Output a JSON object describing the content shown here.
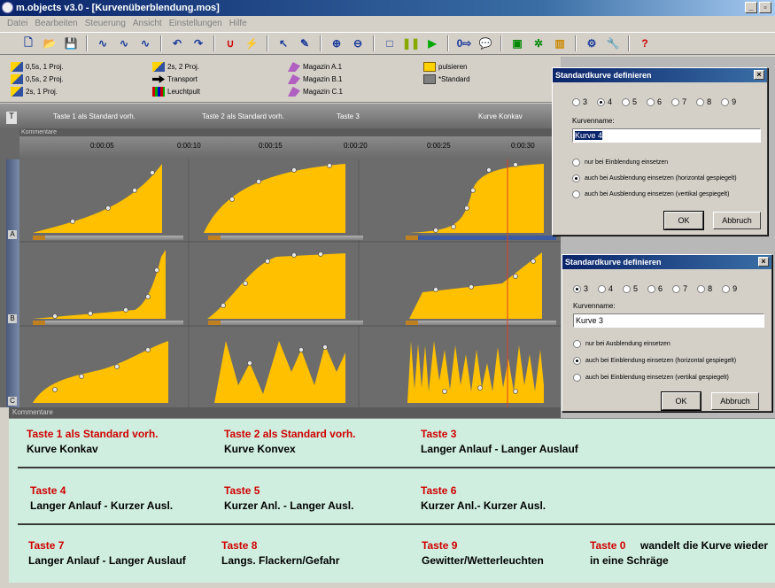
{
  "window": {
    "title": "m.objects v3.0 - [Kurvenüberblendung.mos]",
    "controls": [
      "_",
      "▫",
      "×"
    ]
  },
  "menu": [
    "Datei",
    "Bearbeiten",
    "Steuerung",
    "Ansicht",
    "Einstellungen",
    "Hilfe"
  ],
  "toolbar": [
    "new-icon",
    "open-icon",
    "save-icon",
    "curve-icon",
    "curve-icon",
    "curve-icon",
    "undo-icon",
    "redo-icon",
    "magnet-icon",
    "link-icon",
    "pointer-icon",
    "pen-icon",
    "zoom-in-icon",
    "zoom-out-icon",
    "stop-icon",
    "pause-icon",
    "play-icon",
    "counter-icon",
    "speech-icon",
    "monitor-icon",
    "sync-icon",
    "grid-icon",
    "settings-icon",
    "wrench-icon",
    "help-icon"
  ],
  "objects": [
    {
      "label": "0,5s, 1 Proj.",
      "icon": "yellow"
    },
    {
      "label": "0,5s, 2 Proj.",
      "icon": "yellow"
    },
    {
      "label": "2s, 1 Proj.",
      "icon": "yellow"
    },
    {
      "label": "2s, 2 Proj.",
      "icon": "yellow"
    },
    {
      "label": "Transport",
      "icon": "arrow"
    },
    {
      "label": "Leuchtpult",
      "icon": "light"
    },
    {
      "label": "Magazin A.1",
      "icon": "mag"
    },
    {
      "label": "Magazin B.1",
      "icon": "mag"
    },
    {
      "label": "Magazin C.1",
      "icon": "mag"
    },
    {
      "label": "pulsieren",
      "icon": "puls"
    },
    {
      "label": "*Standard",
      "icon": "std"
    }
  ],
  "track_header": {
    "row_letter": "T",
    "labels": [
      "Taste 1 als Standard vorh.",
      "Taste 2 als Standard vorh.",
      "Taste 3",
      "Kurve Konkav"
    ]
  },
  "kommentare_label": "Kommentare",
  "ruler_ticks": [
    "0:00:05",
    "0:00:10",
    "0:00:15",
    "0:00:20",
    "0:00:25",
    "0:00:30"
  ],
  "row_labels": [
    "A",
    "B",
    "C"
  ],
  "comments": {
    "row1": [
      {
        "key": "Taste 1 als Standard vorh.",
        "value": "Kurve Konkav"
      },
      {
        "key": "Taste 2 als Standard vorh.",
        "value": "Kurve Konvex"
      },
      {
        "key": "Taste 3",
        "value": "Langer Anlauf - Langer Auslauf"
      }
    ],
    "row2": [
      {
        "key": "Taste 4",
        "value": "Langer Anlauf - Kurzer Ausl."
      },
      {
        "key": "Taste 5",
        "value": "Kurzer Anl. - Langer Ausl."
      },
      {
        "key": "Taste 6",
        "value": "Kurzer Anl.- Kurzer Ausl."
      }
    ],
    "row3": [
      {
        "key": "Taste 7",
        "value": "Langer Anlauf - Langer Auslauf"
      },
      {
        "key": "Taste 8",
        "value": "Langs. Flackern/Gefahr"
      },
      {
        "key": "Taste 9",
        "value": "Gewitter/Wetterleuchten"
      }
    ],
    "taste0_key": "Taste 0",
    "taste0_text1": " wandelt die Kurve wieder",
    "taste0_text2": "in eine Schräge"
  },
  "dialog1": {
    "title": "Standardkurve definieren",
    "options": [
      "3",
      "4",
      "5",
      "6",
      "7",
      "8",
      "9"
    ],
    "selected": "4",
    "name_label": "Kurvenname:",
    "name_value": "Kurve 4",
    "radio_opts": [
      "nur bei Einblendung einsetzen",
      "auch bei Ausblendung einsetzen (horizontal gespiegelt)",
      "auch bei Ausblendung einsetzen (vertikal gespiegelt)"
    ],
    "radio_selected": 1,
    "ok": "OK",
    "cancel": "Abbruch"
  },
  "dialog2": {
    "title": "Standardkurve definieren",
    "options": [
      "3",
      "4",
      "5",
      "6",
      "7",
      "8",
      "9"
    ],
    "selected": "3",
    "name_label": "Kurvenname:",
    "name_value": "Kurve 3",
    "radio_opts": [
      "nur bei Ausblendung einsetzen",
      "auch bei Einblendung einsetzen (horizontal gespiegelt)",
      "auch bei Einblendung einsetzen (vertikal gespiegelt)"
    ],
    "radio_selected": 1,
    "ok": "OK",
    "cancel": "Abbruch"
  },
  "colors": {
    "curve_fill": "#ffc000",
    "title_blue": "#0a246a",
    "comment_bg": "#cfeee0",
    "key_red": "#d00000"
  }
}
